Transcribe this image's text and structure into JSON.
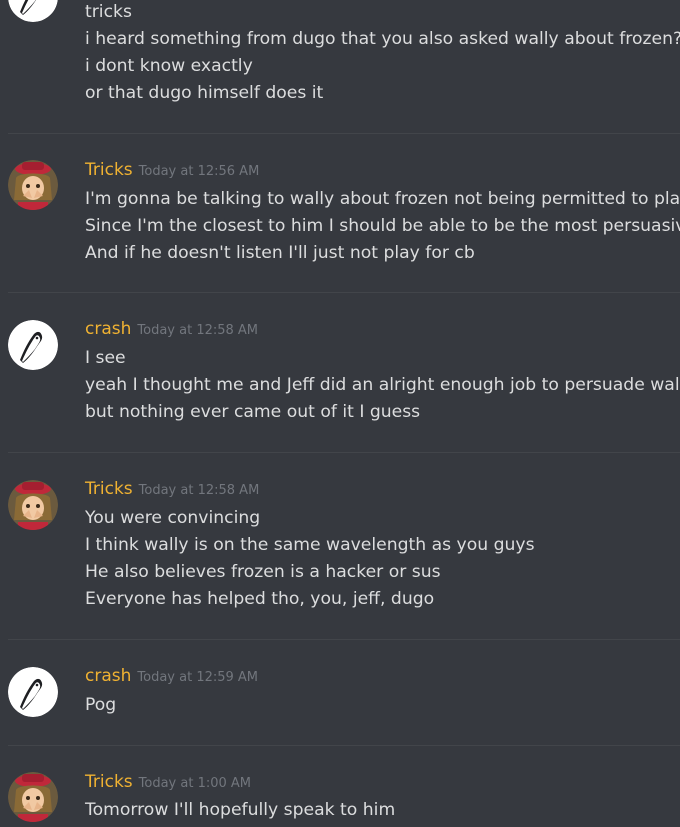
{
  "messages": [
    {
      "author": "",
      "time": "",
      "avatar": "crash-icon",
      "lines": [
        "tricks",
        "i heard something from dugo that you also asked wally about frozen?",
        "i dont know exactly",
        "or that dugo himself does it"
      ]
    },
    {
      "author": "Tricks",
      "time": "Today at 12:56 AM",
      "avatar": "tricks-icon",
      "lines": [
        "I'm gonna be talking to wally about frozen not being permitted to play",
        "Since I'm the closest to him I should be able to be the most persuasive",
        "And if he doesn't listen I'll just not play for cb"
      ]
    },
    {
      "author": "crash",
      "time": "Today at 12:58 AM",
      "avatar": "crash-icon",
      "lines": [
        "I see",
        "yeah I thought me and Jeff did an alright enough job to persuade wally",
        "but nothing ever came out of it I guess"
      ]
    },
    {
      "author": "Tricks",
      "time": "Today at 12:58 AM",
      "avatar": "tricks-icon",
      "lines": [
        "You were convincing",
        "I think wally is on the same wavelength as you guys",
        "He also believes frozen is a hacker or sus",
        "Everyone has helped tho, you, jeff, dugo"
      ]
    },
    {
      "author": "crash",
      "time": "Today at 12:59 AM",
      "avatar": "crash-icon",
      "lines": [
        "Pog"
      ]
    },
    {
      "author": "Tricks",
      "time": "Today at 1:00 AM",
      "avatar": "tricks-icon",
      "lines": [
        "Tomorrow I'll hopefully speak to him"
      ]
    }
  ],
  "colors": {
    "background": "#36393f",
    "username": "#f0b232",
    "timestamp": "#72767d",
    "text": "#dcddde"
  }
}
